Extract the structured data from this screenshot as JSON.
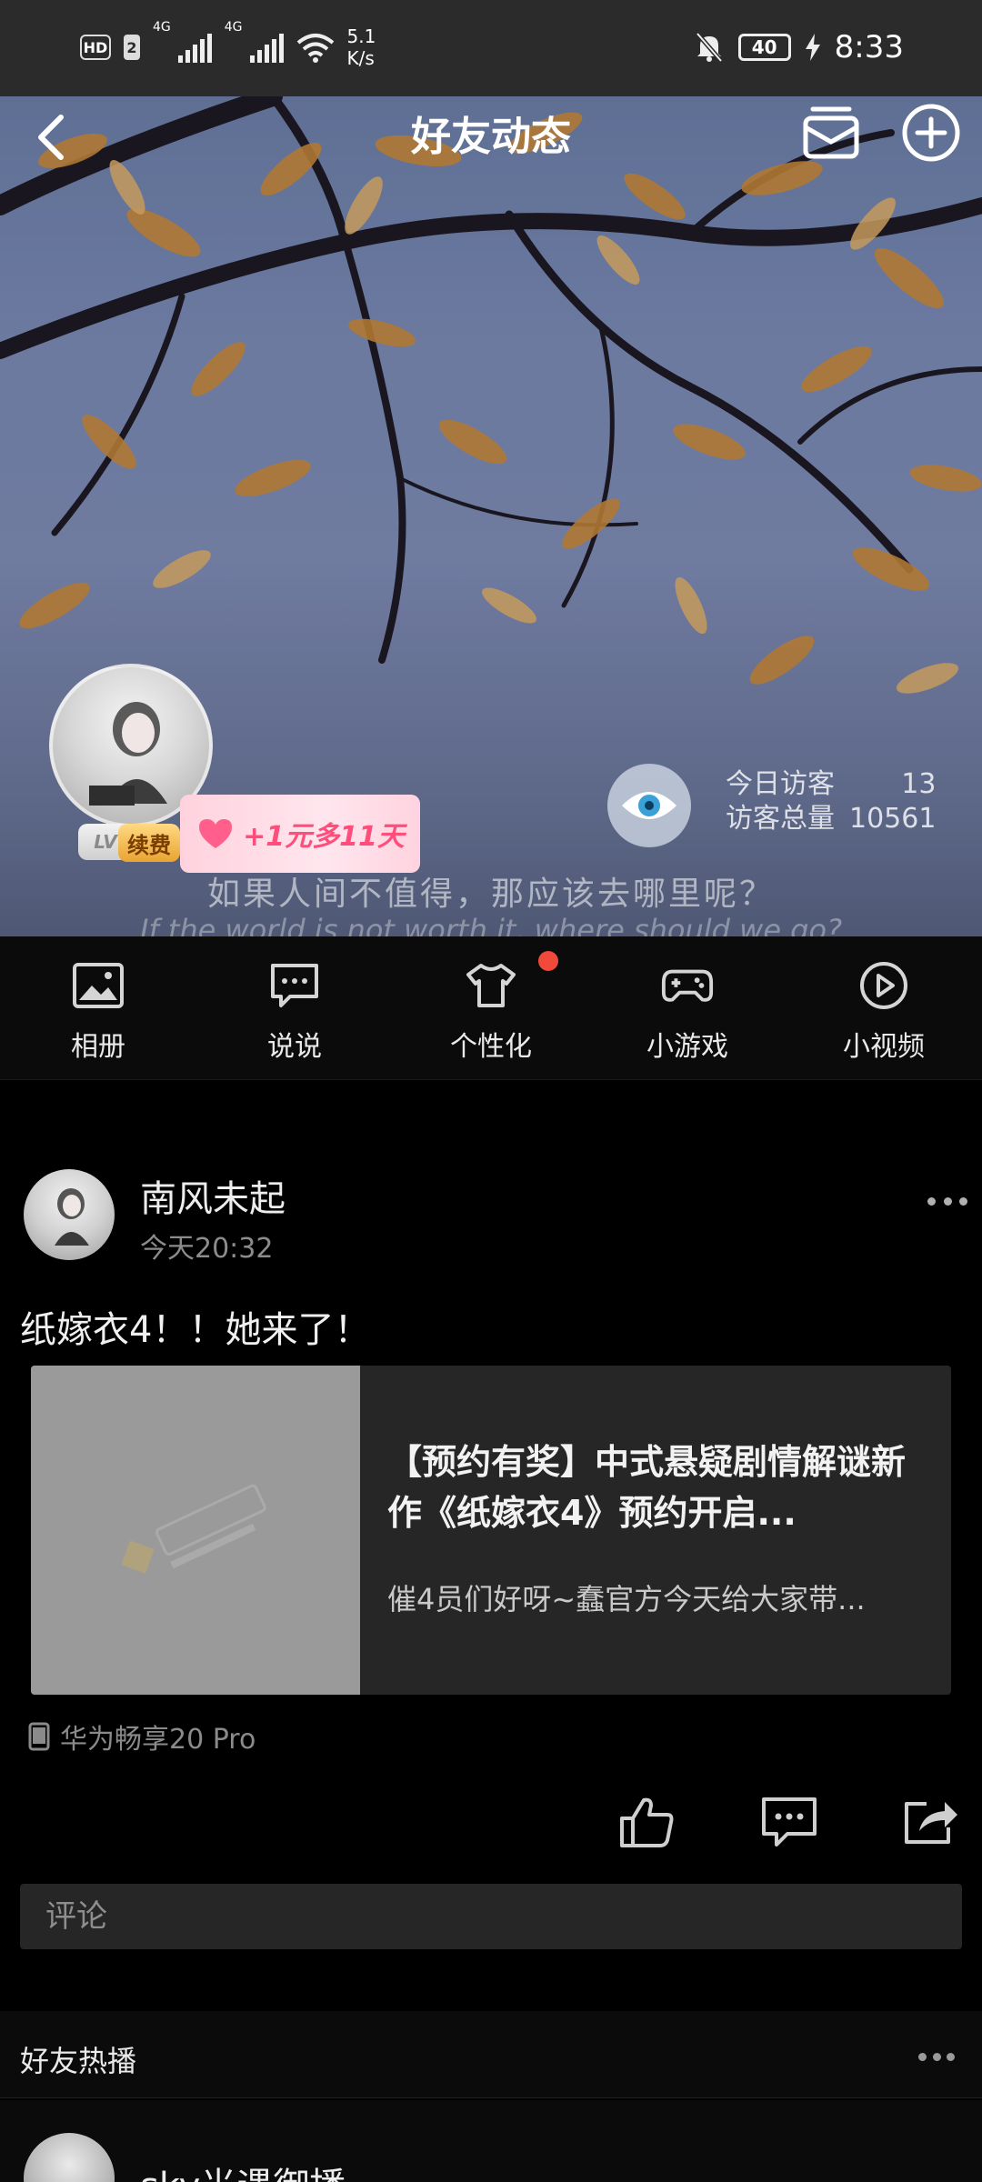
{
  "status_bar": {
    "hd": "HD",
    "sim_badge": "2",
    "net1": "4G",
    "net2": "4G",
    "speed_value": "5.1",
    "speed_unit": "K/s",
    "battery": "40",
    "time": "8:33"
  },
  "header": {
    "title": "好友动态"
  },
  "cover": {
    "level": "LV7",
    "renew_label": "续费",
    "promo_text": "+1元多11天",
    "visitors_today_label": "今日访客",
    "visitors_today_value": "13",
    "visitors_total_label": "访客总量",
    "visitors_total_value": "10561",
    "quote_zh": "如果人间不值得，那应该去哪里呢？",
    "quote_en": "If the world is not worth it, where should we go?"
  },
  "quick_nav": [
    {
      "label": "相册",
      "icon": "photo-icon"
    },
    {
      "label": "说说",
      "icon": "chat-icon"
    },
    {
      "label": "个性化",
      "icon": "shirt-icon"
    },
    {
      "label": "小游戏",
      "icon": "gamepad-icon"
    },
    {
      "label": "小视频",
      "icon": "play-icon"
    }
  ],
  "post": {
    "author": "南风未起",
    "time": "今天20:32",
    "text": "纸嫁衣4！！她来了！",
    "share": {
      "title": "【预约有奖】中式悬疑剧情解谜新作《纸嫁衣4》预约开启...",
      "description": "催4员们好呀~蠢官方今天给大家带..."
    },
    "device": "华为畅享20 Pro",
    "comment_placeholder": "评论"
  },
  "hot": {
    "title": "好友热播",
    "first_author": "sky光遇御播"
  },
  "colors": {
    "status_bar": "#2b2b2b",
    "background": "#000000",
    "card": "#262626",
    "notification_dot": "#f24a3a",
    "promo_pink": "#ff4d7c"
  }
}
